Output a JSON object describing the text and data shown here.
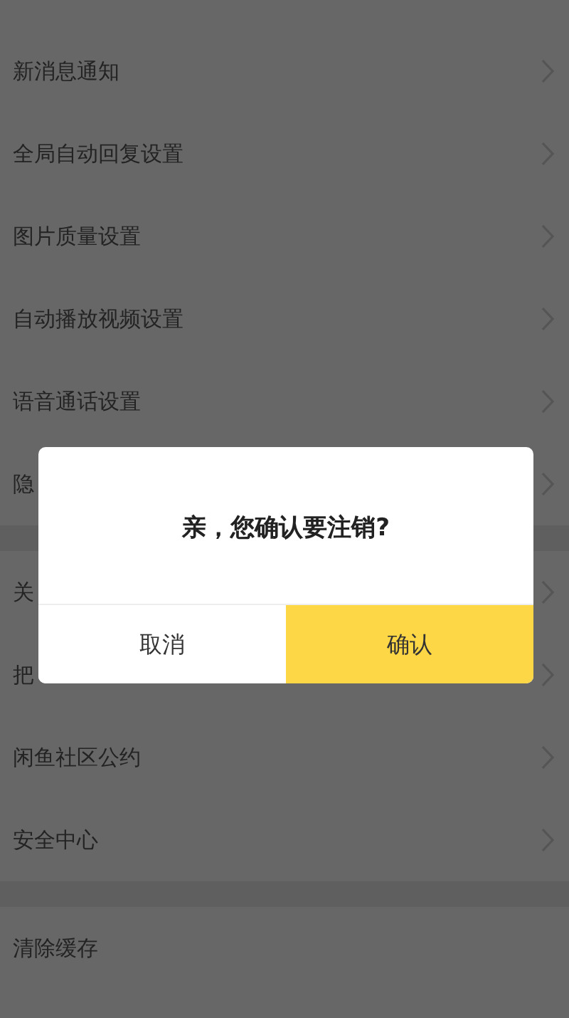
{
  "sections": [
    {
      "items": [
        {
          "label": "新消息通知",
          "chevron": true
        },
        {
          "label": "全局自动回复设置",
          "chevron": true
        },
        {
          "label": "图片质量设置",
          "chevron": true
        },
        {
          "label": "自动播放视频设置",
          "chevron": true
        },
        {
          "label": "语音通话设置",
          "chevron": true
        },
        {
          "label": "隐",
          "chevron": true
        }
      ]
    },
    {
      "items": [
        {
          "label": "关",
          "chevron": true
        },
        {
          "label": "把",
          "chevron": true
        },
        {
          "label": "闲鱼社区公约",
          "chevron": true
        },
        {
          "label": "安全中心",
          "chevron": true
        }
      ]
    },
    {
      "items": [
        {
          "label": "清除缓存",
          "chevron": false
        }
      ]
    }
  ],
  "dialog": {
    "message": "亲，您确认要注销?",
    "buttons": [
      {
        "label": "取消",
        "kind": "cancel"
      },
      {
        "label": "确认",
        "kind": "confirm"
      }
    ]
  }
}
